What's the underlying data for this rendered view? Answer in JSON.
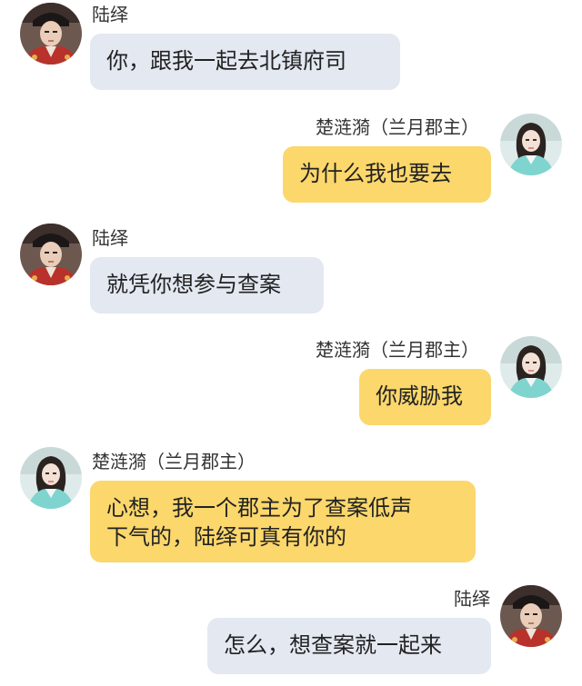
{
  "messages": [
    {
      "side": "left",
      "sender": "陆绎",
      "avatar_icon": "avatar-lu-yi",
      "text": "你，跟我一起去北镇府司",
      "bubble_color": "#e3e8f1"
    },
    {
      "side": "right",
      "sender": "楚涟漪（兰月郡主）",
      "avatar_icon": "avatar-chu-lianyi",
      "text": "为什么我也要去",
      "bubble_color": "#fbd76c"
    },
    {
      "side": "left",
      "sender": "陆绎",
      "avatar_icon": "avatar-lu-yi",
      "text": "就凭你想参与查案",
      "bubble_color": "#e3e8f1"
    },
    {
      "side": "right",
      "sender": "楚涟漪（兰月郡主）",
      "avatar_icon": "avatar-chu-lianyi",
      "text": "你威胁我",
      "bubble_color": "#fbd76c"
    },
    {
      "side": "left",
      "sender": "楚涟漪（兰月郡主）",
      "avatar_icon": "avatar-chu-lianyi",
      "text_line1": "心想，我一个郡主为了查案低声",
      "text_line2": "下气的，陆绎可真有你的",
      "bubble_color": "#fbd76c"
    },
    {
      "side": "right",
      "sender": "陆绎",
      "avatar_icon": "avatar-lu-yi",
      "text": "怎么，想查案就一起来",
      "bubble_color": "#e3e8f1"
    }
  ]
}
